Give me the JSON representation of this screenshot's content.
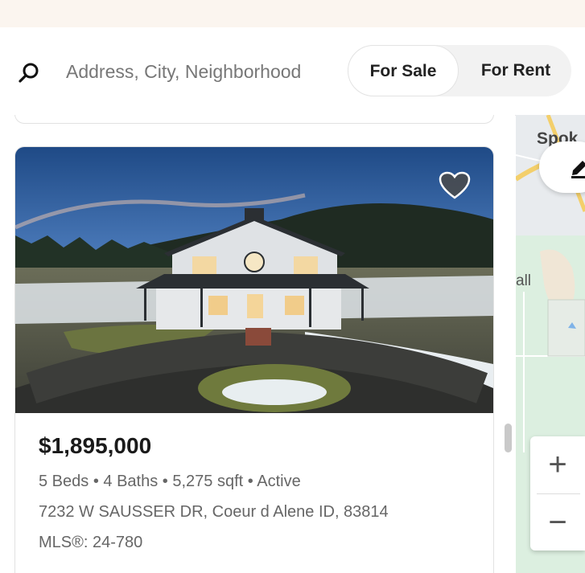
{
  "search": {
    "placeholder": "Address, City, Neighborhood"
  },
  "listing_toggle": {
    "for_sale_label": "For Sale",
    "for_rent_label": "For Rent",
    "selected": "For Sale"
  },
  "listing": {
    "price": "$1,895,000",
    "beds": "5 Beds",
    "baths": "4 Baths",
    "sqft": "5,275 sqft",
    "status": "Active",
    "separator": "•",
    "address": "7232 W SAUSSER DR, Coeur d Alene ID, 83814",
    "mls": "MLS®: 24-780",
    "favorite_icon": "heart-icon"
  },
  "map": {
    "labels": [
      "Spok",
      "all"
    ],
    "zoom_in_label": "+",
    "zoom_out_label": "−",
    "draw_icon": "pencil-icon"
  }
}
